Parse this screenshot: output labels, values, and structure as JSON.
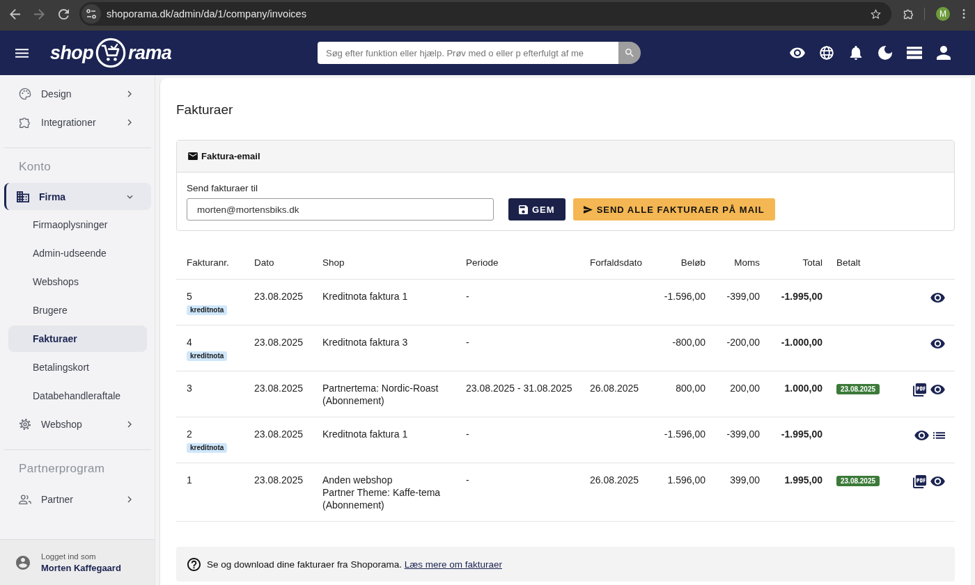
{
  "browser": {
    "url": "shoporama.dk/admin/da/1/company/invoices",
    "forward_disabled": true,
    "profile_initial": "M"
  },
  "header": {
    "logo": {
      "left": "shop",
      "right": "rama"
    },
    "search": {
      "placeholder": "Søg efter funktion eller hjælp. Prøv med o eller p efterfulgt af me"
    }
  },
  "sidebar": {
    "groups": [
      {
        "items": [
          {
            "label": "Design",
            "selected": false,
            "expanded": false
          },
          {
            "label": "Integrationer",
            "selected": false,
            "expanded": false
          }
        ]
      },
      {
        "heading": "Konto",
        "items": [
          {
            "label": "Firma",
            "selected": true,
            "expanded": true,
            "children": [
              {
                "label": "Firmaoplysninger",
                "selected": false
              },
              {
                "label": "Admin-udseende",
                "selected": false
              },
              {
                "label": "Webshops",
                "selected": false
              },
              {
                "label": "Brugere",
                "selected": false
              },
              {
                "label": "Fakturaer",
                "selected": true
              },
              {
                "label": "Betalingskort",
                "selected": false
              },
              {
                "label": "Databehandleraftale",
                "selected": false
              }
            ]
          },
          {
            "label": "Webshop",
            "selected": false,
            "expanded": false
          }
        ]
      },
      {
        "heading": "Partnerprogram",
        "items": [
          {
            "label": "Partner",
            "selected": false,
            "expanded": false
          }
        ]
      }
    ],
    "user": {
      "caption": "Logget ind som",
      "name": "Morten Kaffegaard"
    }
  },
  "page": {
    "title": "Fakturaer",
    "email_card": {
      "title": "Faktura-email",
      "field_label": "Send fakturaer til",
      "email": {
        "value": "morten@mortensbiks.dk"
      },
      "buttons": [
        {
          "kind": "save",
          "label": "GEM"
        },
        {
          "kind": "send",
          "label": "SEND ALLE FAKTURAER PÅ MAIL"
        }
      ]
    },
    "table": {
      "columns": [
        "Fakturanr.",
        "Dato",
        "Shop",
        "Periode",
        "Forfaldsdato",
        "Beløb",
        "Moms",
        "Total",
        "Betalt"
      ],
      "rows": [
        {
          "number": "5",
          "tag": "kreditnota",
          "date": "23.08.2025",
          "shop": [
            "Kreditnota faktura 1"
          ],
          "period": "-",
          "amount": "-1.596,00",
          "vat": "-399,00",
          "total": "-1.995,00",
          "actions": [
            {
              "kind": "view"
            }
          ]
        },
        {
          "number": "4",
          "tag": "kreditnota",
          "date": "23.08.2025",
          "shop": [
            "Kreditnota faktura 3"
          ],
          "period": "-",
          "amount": "-800,00",
          "vat": "-200,00",
          "total": "-1.000,00",
          "actions": [
            {
              "kind": "view"
            }
          ]
        },
        {
          "number": "3",
          "date": "23.08.2025",
          "shop": [
            "Partnertema: Nordic-Roast",
            "(Abonnement)"
          ],
          "period": "23.08.2025 - 31.08.2025",
          "due": "26.08.2025",
          "amount": "800,00",
          "vat": "200,00",
          "total": "1.000,00",
          "paid": "23.08.2025",
          "actions": [
            {
              "kind": "pdf"
            },
            {
              "kind": "view"
            }
          ]
        },
        {
          "number": "2",
          "tag": "kreditnota",
          "date": "23.08.2025",
          "shop": [
            "Kreditnota faktura 1"
          ],
          "period": "-",
          "amount": "-1.596,00",
          "vat": "-399,00",
          "total": "-1.995,00",
          "actions": [
            {
              "kind": "view"
            },
            {
              "kind": "list"
            }
          ]
        },
        {
          "number": "1",
          "date": "23.08.2025",
          "shop": [
            "Anden webshop",
            "Partner Theme: Kaffe-tema",
            "(Abonnement)"
          ],
          "period": "-",
          "due": "26.08.2025",
          "amount": "1.596,00",
          "vat": "399,00",
          "total": "1.995,00",
          "paid": "23.08.2025",
          "actions": [
            {
              "kind": "pdf"
            },
            {
              "kind": "view"
            }
          ]
        }
      ]
    },
    "info": {
      "text": "Se og download dine fakturaer fra Shoporama.",
      "link": "Læs mere om fakturaer"
    }
  }
}
